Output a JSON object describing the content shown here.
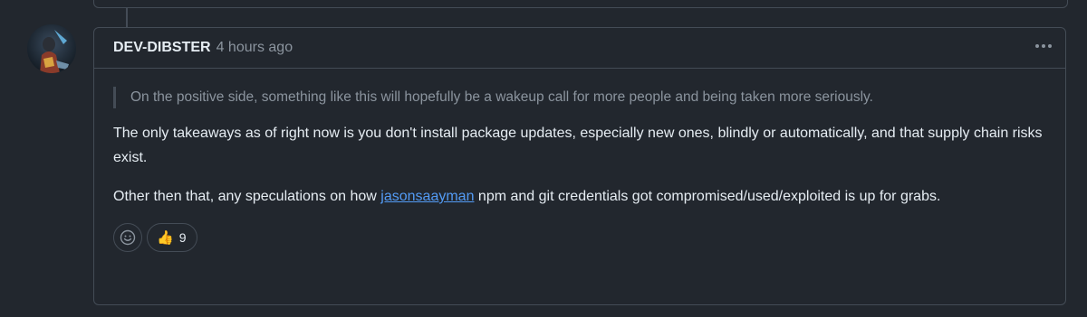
{
  "comment": {
    "author": "DEV-DIBSTER",
    "timestamp": "4 hours ago",
    "quote": "On the positive side, something like this will hopefully be a wakeup call for more people and being taken more seriously.",
    "paragraph1": "The only takeaways as of right now is you don't install package updates, especially new ones, blindly or automatically, and that supply chain risks exist.",
    "paragraph2_before": "Other then that, any speculations on how ",
    "mention": "jasonsaayman",
    "paragraph2_after": " npm and git credentials got compromised/used/exploited is up for grabs."
  },
  "reactions": [
    {
      "emoji": "👍",
      "icon": "thumbs-up-icon",
      "count": "9"
    }
  ],
  "icons": {
    "add_reaction": "smiley-icon",
    "menu": "kebab-menu-icon"
  },
  "colors": {
    "background": "#22272e",
    "border": "#444c56",
    "muted": "#8b949e",
    "link": "#539bf5"
  }
}
